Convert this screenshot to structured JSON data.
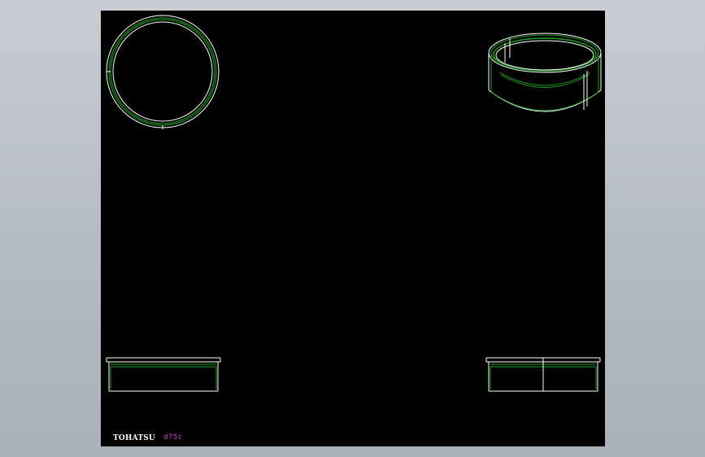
{
  "window": {
    "title": ""
  },
  "title_block": {
    "company": "TOHATSU",
    "part_code": "d75c"
  },
  "colors": {
    "frame": "#b4bac3",
    "canvas": "#000000",
    "outline": "#ffffff",
    "hidden_line": "#1aa31a",
    "part_code_text": "#e040e0"
  },
  "views": [
    "top-view",
    "isometric-view",
    "front-view",
    "side-view"
  ]
}
